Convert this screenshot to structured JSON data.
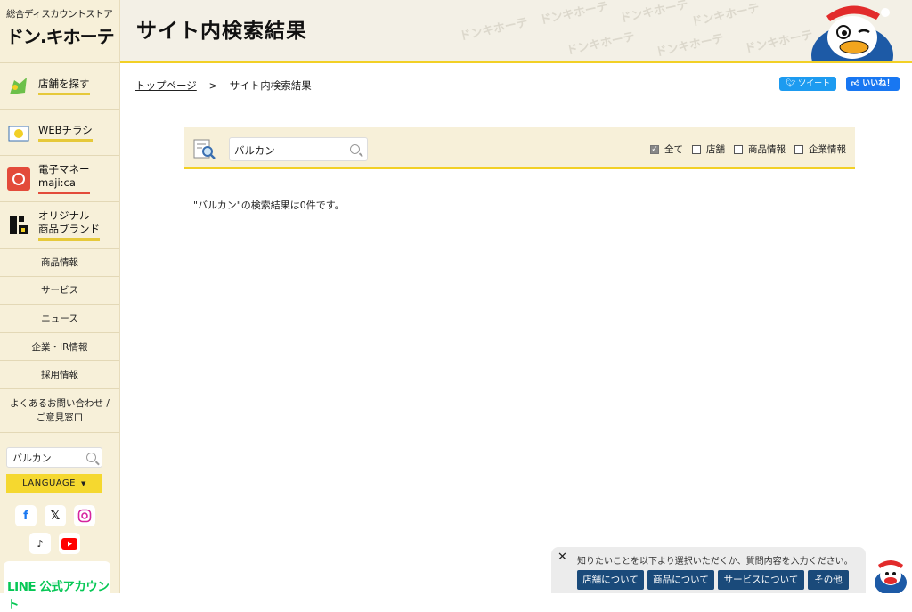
{
  "brand": {
    "tagline": "総合ディスカウントストア",
    "logo": "ドン.キホーテ"
  },
  "header": {
    "title": "サイト内検索結果",
    "watermark": "ドンキホーテ"
  },
  "sidebar": {
    "big_items": [
      {
        "label": "店舗を探す"
      },
      {
        "label": "WEBチラシ"
      },
      {
        "label_line1": "電子マネー",
        "label_line2": "maji:ca"
      },
      {
        "label_line1": "オリジナル",
        "label_line2": "商品ブランド"
      }
    ],
    "small_items": [
      "商品情報",
      "サービス",
      "ニュース",
      "企業・IR情報",
      "採用情報"
    ],
    "contact_line1": "よくあるお問い合わせ /",
    "contact_line2": "ご意見窓口",
    "search_value": "バルカン",
    "language_label": "LANGUAGE",
    "sns": [
      "facebook-icon",
      "x-icon",
      "instagram-icon",
      "tiktok-icon",
      "youtube-icon"
    ],
    "line_label": "LINE 公式アカウント"
  },
  "breadcrumb": {
    "home": "トップページ",
    "separator": ">",
    "current": "サイト内検索結果"
  },
  "social": {
    "tweet": "ツイート",
    "like": "いいね！"
  },
  "search": {
    "value": "バルカン",
    "filters": [
      {
        "label": "全て",
        "checked": true
      },
      {
        "label": "店舗",
        "checked": false
      },
      {
        "label": "商品情報",
        "checked": false
      },
      {
        "label": "企業情報",
        "checked": false
      }
    ]
  },
  "result_text": "\"バルカン\"の検索結果は0件です。",
  "chat": {
    "message": "知りたいことを以下より選択いただくか、質問内容を入力ください。",
    "buttons": [
      "店舗について",
      "商品について",
      "サービスについて",
      "その他"
    ]
  }
}
